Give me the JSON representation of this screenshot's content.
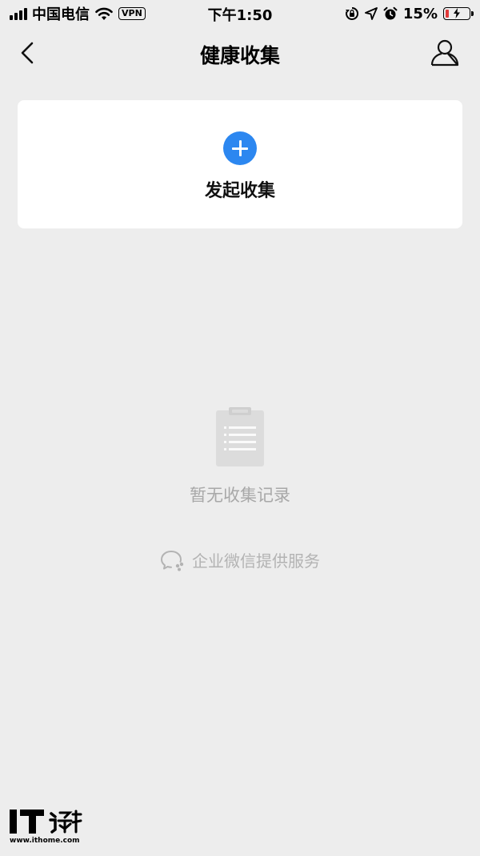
{
  "status_bar": {
    "carrier": "中国电信",
    "vpn": "VPN",
    "time": "下午1:50",
    "battery_percent": "15%",
    "battery_level": 0.15
  },
  "nav": {
    "title": "健康收集"
  },
  "card": {
    "label": "发起收集"
  },
  "empty_state": {
    "text": "暂无收集记录"
  },
  "provider": {
    "text": "企业微信提供服务"
  },
  "watermark": {
    "url": "www.ithome.com"
  },
  "icons": {
    "back": "chevron-left-icon",
    "user": "user-icon",
    "add": "plus-icon",
    "empty": "clipboard-icon",
    "provider": "wecom-logo-icon"
  },
  "colors": {
    "accent": "#2c87f0",
    "background": "#ededed",
    "battery_low": "#e23b3b"
  }
}
